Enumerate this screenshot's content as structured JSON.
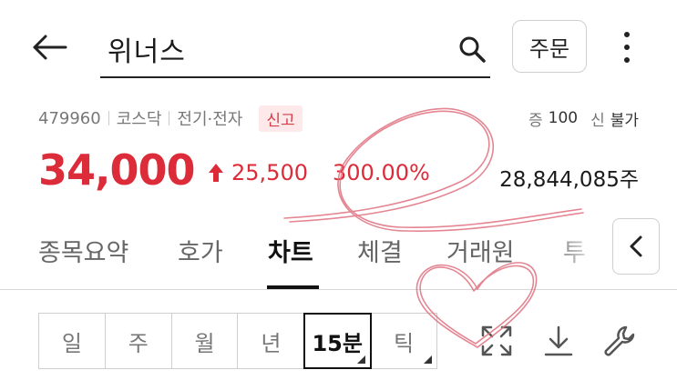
{
  "header": {
    "search_value": "위너스",
    "order_label": "주문"
  },
  "info": {
    "code": "479960",
    "market": "코스닥",
    "sector": "전기·전자",
    "badge": "신고",
    "margin_label": "증",
    "margin_value": "100",
    "credit_label": "신",
    "credit_value": "불가"
  },
  "price": {
    "current": "34,000",
    "change": "25,500",
    "rate": "300.00%",
    "volume": "28,844,085주"
  },
  "tabs": [
    {
      "label": "종목요약"
    },
    {
      "label": "호가"
    },
    {
      "label": "차트"
    },
    {
      "label": "체결"
    },
    {
      "label": "거래원"
    },
    {
      "label": "투"
    }
  ],
  "periods": [
    {
      "label": "일"
    },
    {
      "label": "주"
    },
    {
      "label": "월"
    },
    {
      "label": "년"
    },
    {
      "label": "15분"
    },
    {
      "label": "틱"
    }
  ],
  "colors": {
    "up_red": "#dc2b39",
    "badge_bg": "#fde9ea",
    "scribble": "#e07080"
  },
  "icons": {
    "back": "arrow-left-icon",
    "search": "search-icon",
    "more": "more-vertical-icon",
    "tab_scroll": "chevron-left-icon",
    "expand": "expand-icon",
    "download": "download-icon",
    "settings": "wrench-icon"
  }
}
